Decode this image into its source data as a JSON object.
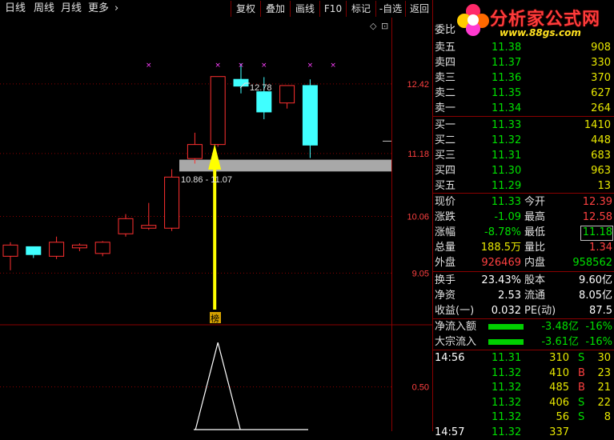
{
  "toolbar": {
    "periods": [
      "日线",
      "周线",
      "月线",
      "更多"
    ],
    "more_arrow": "›",
    "buttons": [
      "复权",
      "叠加",
      "画线",
      "F10",
      "标记",
      "-自选",
      "返回"
    ]
  },
  "logo": {
    "text": "分析家公式网",
    "url": "www.88gs.com"
  },
  "main_chart": {
    "price_labels": [
      "12.42",
      "11.18",
      "10.06",
      "9.05"
    ],
    "high_annotation": "12.78",
    "support_label": "10.86 - 11.07",
    "marker_char": "榜",
    "colors": {
      "up": "#ff3030",
      "down": "#40ffff",
      "grid": "#8a0000",
      "arrow": "#ffff00",
      "band": "#a8a8a8",
      "cross": "#ff40ff"
    }
  },
  "chart_data": {
    "type": "candlestick",
    "ohlc": [
      {
        "o": 9.35,
        "h": 9.6,
        "l": 9.1,
        "c": 9.55
      },
      {
        "o": 9.52,
        "h": 9.52,
        "l": 9.32,
        "c": 9.38
      },
      {
        "o": 9.35,
        "h": 9.7,
        "l": 9.3,
        "c": 9.6
      },
      {
        "o": 9.5,
        "h": 9.58,
        "l": 9.44,
        "c": 9.55
      },
      {
        "o": 9.4,
        "h": 9.62,
        "l": 9.35,
        "c": 9.6
      },
      {
        "o": 9.75,
        "h": 10.1,
        "l": 9.7,
        "c": 10.02
      },
      {
        "o": 9.85,
        "h": 10.3,
        "l": 9.82,
        "c": 9.9
      },
      {
        "o": 9.85,
        "h": 10.9,
        "l": 9.8,
        "c": 10.76
      },
      {
        "o": 11.09,
        "h": 11.55,
        "l": 11.0,
        "c": 11.34
      },
      {
        "o": 11.34,
        "h": 12.55,
        "l": 11.3,
        "c": 12.55
      },
      {
        "o": 12.5,
        "h": 12.78,
        "l": 12.25,
        "c": 12.38
      },
      {
        "o": 12.28,
        "h": 12.54,
        "l": 11.79,
        "c": 11.92
      },
      {
        "o": 12.08,
        "h": 12.39,
        "l": 11.98,
        "c": 12.39
      },
      {
        "o": 12.39,
        "h": 12.5,
        "l": 11.1,
        "c": 11.33
      }
    ],
    "cross_marks": [
      6,
      9,
      10,
      11,
      13,
      14
    ],
    "ylim": [
      8.5,
      13.6
    ],
    "indicator_labels": [
      "0.50"
    ],
    "indicator_values": [
      0,
      0,
      0,
      0,
      0,
      0,
      0,
      0,
      0,
      1,
      0,
      0,
      0,
      0
    ],
    "indicator_ylim": [
      0,
      1.2
    ]
  },
  "quotes": {
    "header": "委比",
    "sell": [
      {
        "label": "卖五",
        "price": "11.38",
        "vol": "908"
      },
      {
        "label": "卖四",
        "price": "11.37",
        "vol": "330"
      },
      {
        "label": "卖三",
        "price": "11.36",
        "vol": "370"
      },
      {
        "label": "卖二",
        "price": "11.35",
        "vol": "627"
      },
      {
        "label": "卖一",
        "price": "11.34",
        "vol": "264"
      }
    ],
    "buy": [
      {
        "label": "买一",
        "price": "11.33",
        "vol": "1410"
      },
      {
        "label": "买二",
        "price": "11.32",
        "vol": "448"
      },
      {
        "label": "买三",
        "price": "11.31",
        "vol": "683"
      },
      {
        "label": "买四",
        "price": "11.30",
        "vol": "963"
      },
      {
        "label": "买五",
        "price": "11.29",
        "vol": "13"
      }
    ]
  },
  "stats": {
    "r1": [
      "现价",
      "11.33",
      "今开",
      "12.39"
    ],
    "r2": [
      "涨跌",
      "-1.09",
      "最高",
      "12.58"
    ],
    "r3": [
      "涨幅",
      "-8.78%",
      "最低",
      "11.18"
    ],
    "r4": [
      "总量",
      "188.5万",
      "量比",
      "1.34"
    ],
    "r5": [
      "外盘",
      "926469",
      "内盘",
      "958562"
    ],
    "r6": [
      "换手",
      "23.43%",
      "股本",
      "9.60亿"
    ],
    "r7": [
      "净资",
      "2.53",
      "流通",
      "8.05亿"
    ],
    "r8": [
      "收益(一)",
      "0.032",
      "PE(动)",
      "87.5"
    ]
  },
  "flows": [
    {
      "label": "净流入额",
      "value": "-3.48亿",
      "pct": "-16%"
    },
    {
      "label": "大宗流入",
      "value": "-3.61亿",
      "pct": "-16%"
    }
  ],
  "ticks": [
    {
      "time": "14:56",
      "price": "11.31",
      "vol": "310",
      "side": "S",
      "num": "30"
    },
    {
      "time": "",
      "price": "11.32",
      "vol": "410",
      "side": "B",
      "num": "23"
    },
    {
      "time": "",
      "price": "11.32",
      "vol": "485",
      "side": "B",
      "num": "21"
    },
    {
      "time": "",
      "price": "11.32",
      "vol": "406",
      "side": "S",
      "num": "22"
    },
    {
      "time": "",
      "price": "11.32",
      "vol": "56",
      "side": "S",
      "num": "8"
    },
    {
      "time": "14:57",
      "price": "11.32",
      "vol": "337",
      "side": "",
      "num": ""
    }
  ]
}
